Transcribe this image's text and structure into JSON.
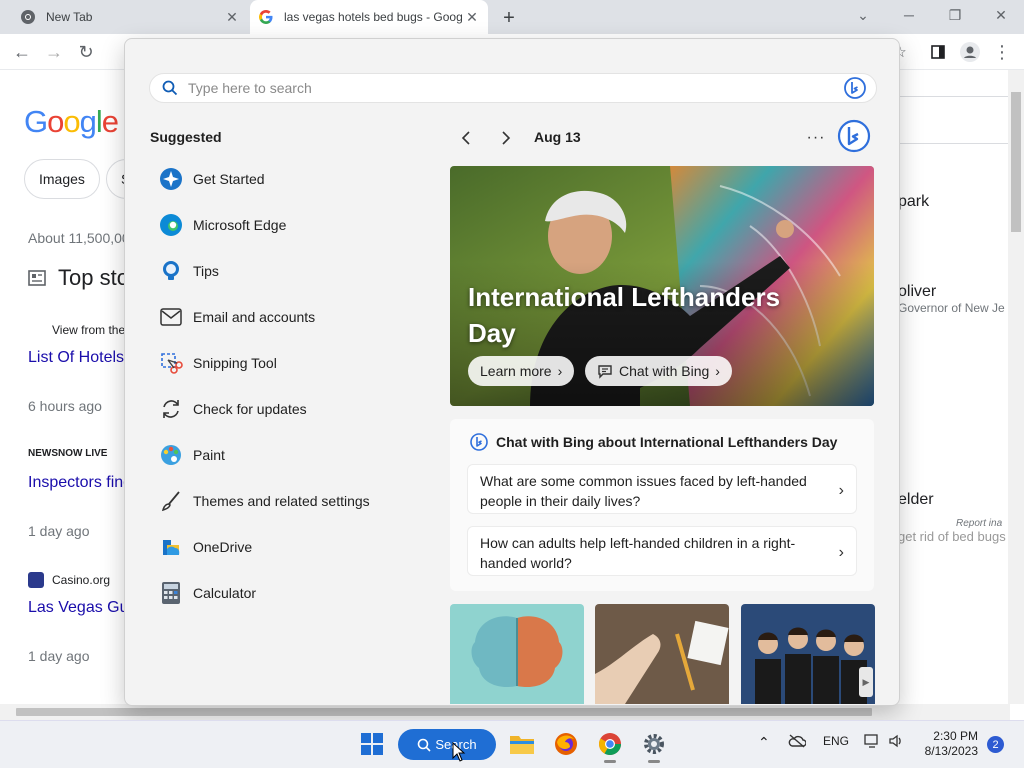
{
  "browser": {
    "tabs": [
      {
        "title": "New Tab"
      },
      {
        "title": "las vegas hotels bed bugs - Goog"
      }
    ],
    "new_tab_symbol": "+"
  },
  "google_page": {
    "logo_text": "Google",
    "chips": [
      "Images",
      "S"
    ],
    "result_count": "About 11,500,00",
    "top_stories": "Top sto",
    "items": [
      {
        "source": "View from the",
        "title": "List Of Hotels",
        "time": "6 hours ago"
      },
      {
        "source": "NEWSNOW LIVE",
        "title": "Inspectors find",
        "time": "1 day ago"
      },
      {
        "source": "Casino.org",
        "title": "Las Vegas Gu",
        "time": "1 day ago"
      }
    ],
    "right_snippets": [
      "park",
      "oliver",
      "Governor of New Je",
      "elder",
      "Report ina",
      "get rid of bed bugs"
    ]
  },
  "flyout": {
    "search_placeholder": "Type here to search",
    "suggested_title": "Suggested",
    "suggested": [
      {
        "label": "Get Started",
        "icon": "get-started-icon"
      },
      {
        "label": "Microsoft Edge",
        "icon": "edge-icon"
      },
      {
        "label": "Tips",
        "icon": "tips-icon"
      },
      {
        "label": "Email and accounts",
        "icon": "mail-icon"
      },
      {
        "label": "Snipping Tool",
        "icon": "snipping-tool-icon"
      },
      {
        "label": "Check for updates",
        "icon": "refresh-icon"
      },
      {
        "label": "Paint",
        "icon": "paint-icon"
      },
      {
        "label": "Themes and related settings",
        "icon": "brush-icon"
      },
      {
        "label": "OneDrive",
        "icon": "onedrive-icon"
      },
      {
        "label": "Calculator",
        "icon": "calculator-icon"
      }
    ],
    "date": "Aug 13",
    "hero": {
      "title": "International Lefthanders Day",
      "learn_more": "Learn more",
      "chat_with_bing": "Chat with Bing"
    },
    "chat_card": {
      "title": "Chat with Bing about International Lefthanders Day",
      "questions": [
        "What are some common issues faced by left-handed people in their daily lives?",
        "How can adults help left-handed children in a right-handed world?"
      ]
    }
  },
  "taskbar": {
    "search_label": "Search",
    "language": "ENG",
    "time": "2:30 PM",
    "date": "8/13/2023",
    "notification_count": "2"
  },
  "colors": {
    "accent": "#1f6ed4",
    "bing": "#2f6fdc"
  }
}
